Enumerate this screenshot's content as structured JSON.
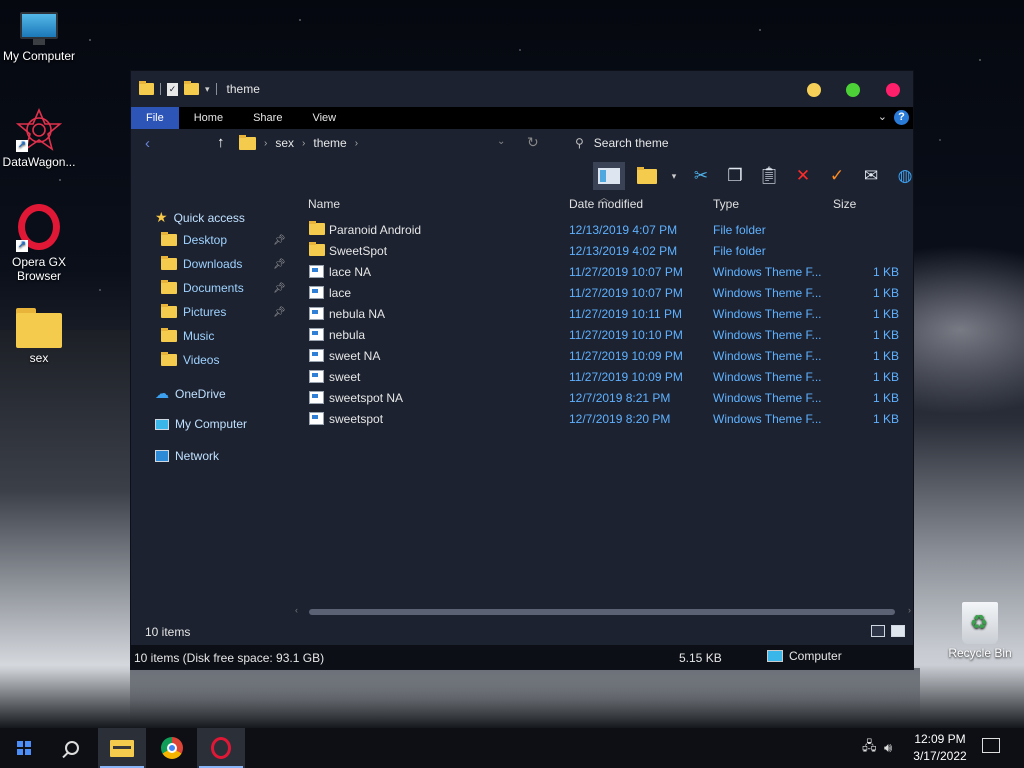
{
  "desktop": {
    "icons": [
      {
        "label": "My Computer",
        "icon": "monitor-icon"
      },
      {
        "label": "DataWagon...",
        "icon": "datawagon-icon"
      },
      {
        "label": "Opera GX Browser",
        "icon": "opera-icon"
      },
      {
        "label": "sex",
        "icon": "folder-icon"
      }
    ],
    "recycle_bin": "Recycle Bin"
  },
  "window": {
    "title": "theme",
    "ribbon_tabs": [
      "File",
      "Home",
      "Share",
      "View"
    ],
    "active_tab": "File",
    "help": "?",
    "breadcrumb": [
      "sex",
      "theme"
    ],
    "search_placeholder": "Search theme",
    "nav": {
      "quick_access": "Quick access",
      "pinned": [
        "Desktop",
        "Downloads",
        "Documents",
        "Pictures"
      ],
      "unpinned": [
        "Music",
        "Videos"
      ],
      "onedrive": "OneDrive",
      "computer": "My Computer",
      "network": "Network"
    },
    "columns": {
      "name": "Name",
      "date": "Date modified",
      "type": "Type",
      "size": "Size"
    },
    "files": [
      {
        "name": "Paranoid Android",
        "date": "12/13/2019 4:07 PM",
        "type": "File folder",
        "size": "",
        "kind": "folder"
      },
      {
        "name": "SweetSpot",
        "date": "12/13/2019 4:02 PM",
        "type": "File folder",
        "size": "",
        "kind": "folder"
      },
      {
        "name": "lace NA",
        "date": "11/27/2019 10:07 PM",
        "type": "Windows Theme F...",
        "size": "1 KB",
        "kind": "theme"
      },
      {
        "name": "lace",
        "date": "11/27/2019 10:07 PM",
        "type": "Windows Theme F...",
        "size": "1 KB",
        "kind": "theme"
      },
      {
        "name": "nebula NA",
        "date": "11/27/2019 10:11 PM",
        "type": "Windows Theme F...",
        "size": "1 KB",
        "kind": "theme"
      },
      {
        "name": "nebula",
        "date": "11/27/2019 10:10 PM",
        "type": "Windows Theme F...",
        "size": "1 KB",
        "kind": "theme"
      },
      {
        "name": "sweet NA",
        "date": "11/27/2019 10:09 PM",
        "type": "Windows Theme F...",
        "size": "1 KB",
        "kind": "theme"
      },
      {
        "name": "sweet",
        "date": "11/27/2019 10:09 PM",
        "type": "Windows Theme F...",
        "size": "1 KB",
        "kind": "theme"
      },
      {
        "name": "sweetspot NA",
        "date": "12/7/2019 8:21 PM",
        "type": "Windows Theme F...",
        "size": "1 KB",
        "kind": "theme"
      },
      {
        "name": "sweetspot",
        "date": "12/7/2019 8:20 PM",
        "type": "Windows Theme F...",
        "size": "1 KB",
        "kind": "theme"
      }
    ],
    "status_count": "10 items",
    "details_left": "10 items (Disk free space: 93.1 GB)",
    "details_size": "5.15 KB",
    "details_location": "Computer"
  },
  "taskbar": {
    "time": "12:09 PM",
    "date": "3/17/2022"
  },
  "colors": {
    "accent": "#2d55b8",
    "link": "#5fb1ff",
    "window_bg": "#1c2230",
    "close": "#ff1f6a",
    "maximize": "#4cd137",
    "minimize": "#f5cf57"
  }
}
